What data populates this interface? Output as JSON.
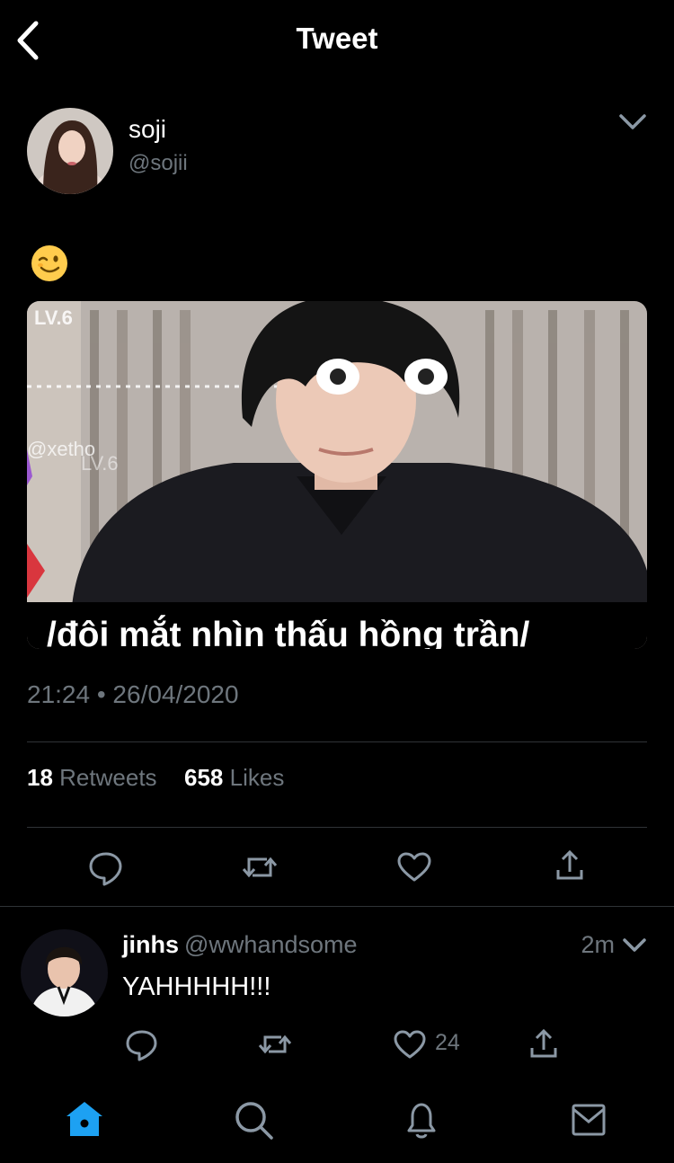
{
  "header": {
    "title": "Tweet",
    "back_icon": "chevron-left-icon"
  },
  "tweet": {
    "author_name": "soji",
    "author_handle": "@sojii",
    "emoji": "winking-face-emoji",
    "media": {
      "caption": "/đôi mắt nhìn thấu hồng trần/",
      "overlay_level": "LV.6",
      "overlay_handle": "@xetho",
      "overlay_level2": "LV.6"
    },
    "timestamp": "21:24 • 26/04/2020",
    "retweets_count": "18",
    "retweets_label": "Retweets",
    "likes_count": "658",
    "likes_label": "Likes",
    "actions": [
      "reply-icon",
      "retweet-icon",
      "like-icon",
      "share-icon"
    ]
  },
  "reply": {
    "name": "jinhs",
    "handle": "@wwhandsome",
    "time": "2m",
    "text": "YAHHHHH!!!",
    "like_count": "24"
  },
  "tabbar": {
    "items": [
      "home-icon",
      "search-icon",
      "notifications-icon",
      "messages-icon"
    ],
    "active_color": "#1da1f2"
  },
  "colors": {
    "background": "#000000",
    "secondary_text": "#6e767d",
    "divider": "#2f3336",
    "accent": "#1da1f2"
  }
}
